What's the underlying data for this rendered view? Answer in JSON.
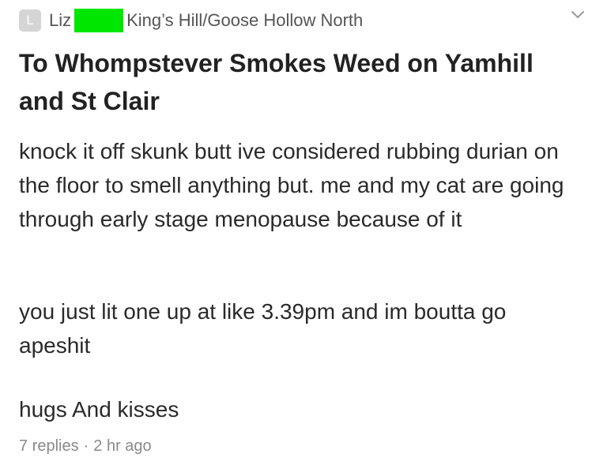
{
  "post": {
    "author": {
      "avatar_letter": "L",
      "first_name": "Liz",
      "last_name_redaction_color": "#00e600",
      "neighborhood": "King’s Hill/Goose Hollow North"
    },
    "menu_icon": "chevron-down-icon",
    "title": "To Whompstever Smokes Weed on Yamhill and St Clair",
    "paragraphs": [
      "knock it off skunk butt ive considered rubbing durian on the floor to smell anything but. me and my cat are going through early stage menopause because of it",
      "you just lit one up at like 3.39pm and im boutta go apeshit",
      "hugs And kisses"
    ],
    "meta": {
      "replies": "7 replies",
      "separator": "·",
      "time": "2 hr ago"
    }
  }
}
